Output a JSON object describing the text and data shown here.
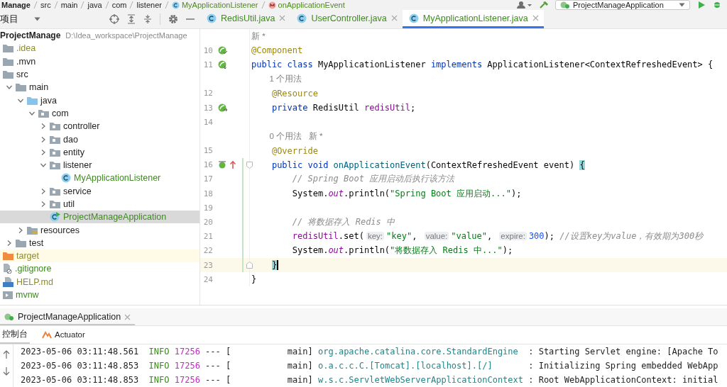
{
  "breadcrumb": [
    {
      "kind": "module",
      "text": "Manage"
    },
    {
      "kind": "dir",
      "text": "src"
    },
    {
      "kind": "dir",
      "text": "main"
    },
    {
      "kind": "dir",
      "text": "java"
    },
    {
      "kind": "dir",
      "text": "com"
    },
    {
      "kind": "dir",
      "text": "listener"
    },
    {
      "kind": "class",
      "text": "MyApplicationListener"
    },
    {
      "kind": "method",
      "text": "onApplicationEvent"
    }
  ],
  "run_config": {
    "label": "ProjectManageApplication"
  },
  "project_view": {
    "label": "项目"
  },
  "tabs": [
    {
      "label": "RedisUtil.java",
      "selected": false
    },
    {
      "label": "UserController.java",
      "selected": false
    },
    {
      "label": "MyApplicationListener.java",
      "selected": true
    }
  ],
  "project": {
    "name": "ProjectManage",
    "path": "D:\\Idea_workspace\\ProjectManage",
    "items": [
      {
        "label": ".idea",
        "kind": "folder",
        "color": "#8c8c2c",
        "selected": false
      },
      {
        "label": ".mvn",
        "kind": "folder",
        "selected": false
      },
      {
        "label": "src",
        "kind": "folder",
        "expanded": true,
        "selected": false,
        "children": [
          {
            "label": "main",
            "kind": "folder",
            "expanded": true,
            "selected": false,
            "children": [
              {
                "label": "java",
                "kind": "source-folder",
                "expanded": true,
                "selected": false,
                "children": [
                  {
                    "label": "com",
                    "kind": "package",
                    "expanded": true,
                    "selected": false,
                    "children": [
                      {
                        "label": "controller",
                        "kind": "package",
                        "expanded": false,
                        "selected": false
                      },
                      {
                        "label": "dao",
                        "kind": "package",
                        "expanded": false,
                        "selected": false
                      },
                      {
                        "label": "entity",
                        "kind": "package",
                        "expanded": false,
                        "selected": false
                      },
                      {
                        "label": "listener",
                        "kind": "package",
                        "expanded": true,
                        "selected": false,
                        "children": [
                          {
                            "label": "MyApplicationListener",
                            "kind": "class",
                            "color": "#3d8a1e",
                            "selected": false
                          }
                        ]
                      },
                      {
                        "label": "service",
                        "kind": "package",
                        "expanded": false,
                        "selected": false
                      },
                      {
                        "label": "util",
                        "kind": "package",
                        "expanded": false,
                        "selected": false
                      },
                      {
                        "label": "ProjectManageApplication",
                        "kind": "app-class",
                        "color": "#3d8a1e",
                        "selected": true
                      }
                    ]
                  }
                ]
              },
              {
                "label": "resources",
                "kind": "resources-folder",
                "expanded": false,
                "selected": false
              }
            ]
          },
          {
            "label": "test",
            "kind": "folder",
            "expanded": false,
            "selected": false
          }
        ]
      },
      {
        "label": "target",
        "kind": "excluded-folder",
        "color": "#8c8c2c",
        "selected": false
      },
      {
        "label": ".gitignore",
        "kind": "ignore-file",
        "color": "#3d8a1e",
        "selected": false
      },
      {
        "label": "HELP.md",
        "kind": "markdown-file",
        "color": "#8c8c2c",
        "selected": false
      },
      {
        "label": "mvnw",
        "kind": "script-file",
        "color": "#3d8a1e",
        "selected": false
      }
    ]
  },
  "editor": {
    "lines": [
      {
        "kind": "hint",
        "text": "新 *"
      },
      {
        "kind": "code",
        "number": "10",
        "gutter": [
          {
            "kind": "bean-check"
          }
        ],
        "tokens": [
          {
            "kind": "annotation",
            "text": "@Component"
          }
        ]
      },
      {
        "kind": "code",
        "number": "11",
        "gutter": [
          {
            "kind": "bean-nav"
          }
        ],
        "tokens": [
          {
            "kind": "keyword",
            "text": "public class "
          },
          {
            "kind": "plain",
            "text": "MyApplicationListener "
          },
          {
            "kind": "keyword",
            "text": "implements "
          },
          {
            "kind": "plain",
            "text": "ApplicationListener<ContextRefreshedEvent> {"
          }
        ]
      },
      {
        "kind": "member-hint",
        "text": "1 个用法"
      },
      {
        "kind": "code",
        "number": "12",
        "tokens": [
          {
            "kind": "annotation",
            "text": "    @Resource"
          }
        ]
      },
      {
        "kind": "code",
        "number": "13",
        "gutter": [
          {
            "kind": "bean-link"
          }
        ],
        "tokens": [
          {
            "kind": "keyword",
            "text": "    private "
          },
          {
            "kind": "plain",
            "text": "RedisUtil "
          },
          {
            "kind": "field",
            "text": "redisUtil"
          },
          {
            "kind": "plain",
            "text": ";"
          }
        ]
      },
      {
        "kind": "code",
        "number": "14"
      },
      {
        "kind": "member-hint",
        "text": "0 个用法   新 *"
      },
      {
        "kind": "code",
        "number": "15",
        "tokens": [
          {
            "kind": "annotation",
            "text": "    @Override"
          }
        ]
      },
      {
        "kind": "code",
        "number": "16",
        "gutter": [
          {
            "kind": "bean-listener"
          },
          {
            "kind": "override"
          }
        ],
        "fold_start": true,
        "changed": true,
        "tokens": [
          {
            "kind": "keyword",
            "text": "    public void "
          },
          {
            "kind": "method",
            "text": "onApplicationEvent"
          },
          {
            "kind": "plain",
            "text": "(ContextRefreshedEvent event) "
          },
          {
            "kind": "brace",
            "text": "{"
          }
        ]
      },
      {
        "kind": "code",
        "number": "17",
        "changed": true,
        "tokens": [
          {
            "kind": "comment",
            "text": "        // Spring Boot 应用启动后执行该方法"
          }
        ]
      },
      {
        "kind": "code",
        "number": "18",
        "changed": true,
        "tokens": [
          {
            "kind": "plain",
            "text": "        System."
          },
          {
            "kind": "static",
            "text": "out"
          },
          {
            "kind": "plain",
            "text": ".println("
          },
          {
            "kind": "string",
            "text": "\"Spring Boot 应用启动...\""
          },
          {
            "kind": "plain",
            "text": ");"
          }
        ]
      },
      {
        "kind": "code",
        "number": "19",
        "changed": true
      },
      {
        "kind": "code",
        "number": "20",
        "changed": true,
        "tokens": [
          {
            "kind": "comment",
            "text": "        // 将数据存入 Redis 中"
          }
        ]
      },
      {
        "kind": "code",
        "number": "21",
        "changed": true,
        "tokens": [
          {
            "kind": "field",
            "text": "        redisUtil"
          },
          {
            "kind": "plain",
            "text": ".set("
          },
          {
            "kind": "param",
            "text": "key:"
          },
          {
            "kind": "string",
            "text": "\"key\""
          },
          {
            "kind": "plain",
            "text": ", "
          },
          {
            "kind": "param",
            "text": "value:"
          },
          {
            "kind": "string",
            "text": "\"value\""
          },
          {
            "kind": "plain",
            "text": ", "
          },
          {
            "kind": "param",
            "text": "expire:"
          },
          {
            "kind": "number",
            "text": "300"
          },
          {
            "kind": "plain",
            "text": "); "
          },
          {
            "kind": "comment",
            "text": "//设置key为value，有效期为300秒"
          }
        ]
      },
      {
        "kind": "code",
        "number": "22",
        "changed": true,
        "tokens": [
          {
            "kind": "plain",
            "text": "        System."
          },
          {
            "kind": "static",
            "text": "out"
          },
          {
            "kind": "plain",
            "text": ".println("
          },
          {
            "kind": "string",
            "text": "\"将数据存入 Redis 中...\""
          },
          {
            "kind": "plain",
            "text": ");"
          }
        ]
      },
      {
        "kind": "code",
        "number": "23",
        "fold_end": true,
        "changed": true,
        "current": true,
        "tokens": [
          {
            "kind": "brace",
            "text": "    }",
            "caret": true
          }
        ]
      },
      {
        "kind": "code",
        "number": "24",
        "tokens": [
          {
            "kind": "plain",
            "text": "}"
          }
        ]
      }
    ]
  },
  "run_panel": {
    "tab": "ProjectManageApplication",
    "subtabs": [
      {
        "label": "控制台",
        "kind": "console",
        "selected": true
      },
      {
        "label": "Actuator",
        "kind": "actuator",
        "selected": false
      }
    ],
    "log": [
      {
        "time": "2023-05-06 03:11:48.561",
        "level": "INFO",
        "pid": "17256",
        "thread": "--- [           main]",
        "logger": "org.apache.catalina.core.StandardEngine",
        "message": ": Starting Servlet engine: [Apache To"
      },
      {
        "time": "2023-05-06 03:11:48.853",
        "level": "INFO",
        "pid": "17256",
        "thread": "--- [           main]",
        "logger": "o.a.c.c.C.[Tomcat].[localhost].[/]",
        "message": ": Initializing Spring embedded WebApp"
      },
      {
        "time": "2023-05-06 03:11:48.853",
        "level": "INFO",
        "pid": "17256",
        "thread": "--- [           main]",
        "logger": "w.s.c.ServletWebServerApplicationContext",
        "message": ": Root WebApplicationContext: initial"
      }
    ]
  }
}
